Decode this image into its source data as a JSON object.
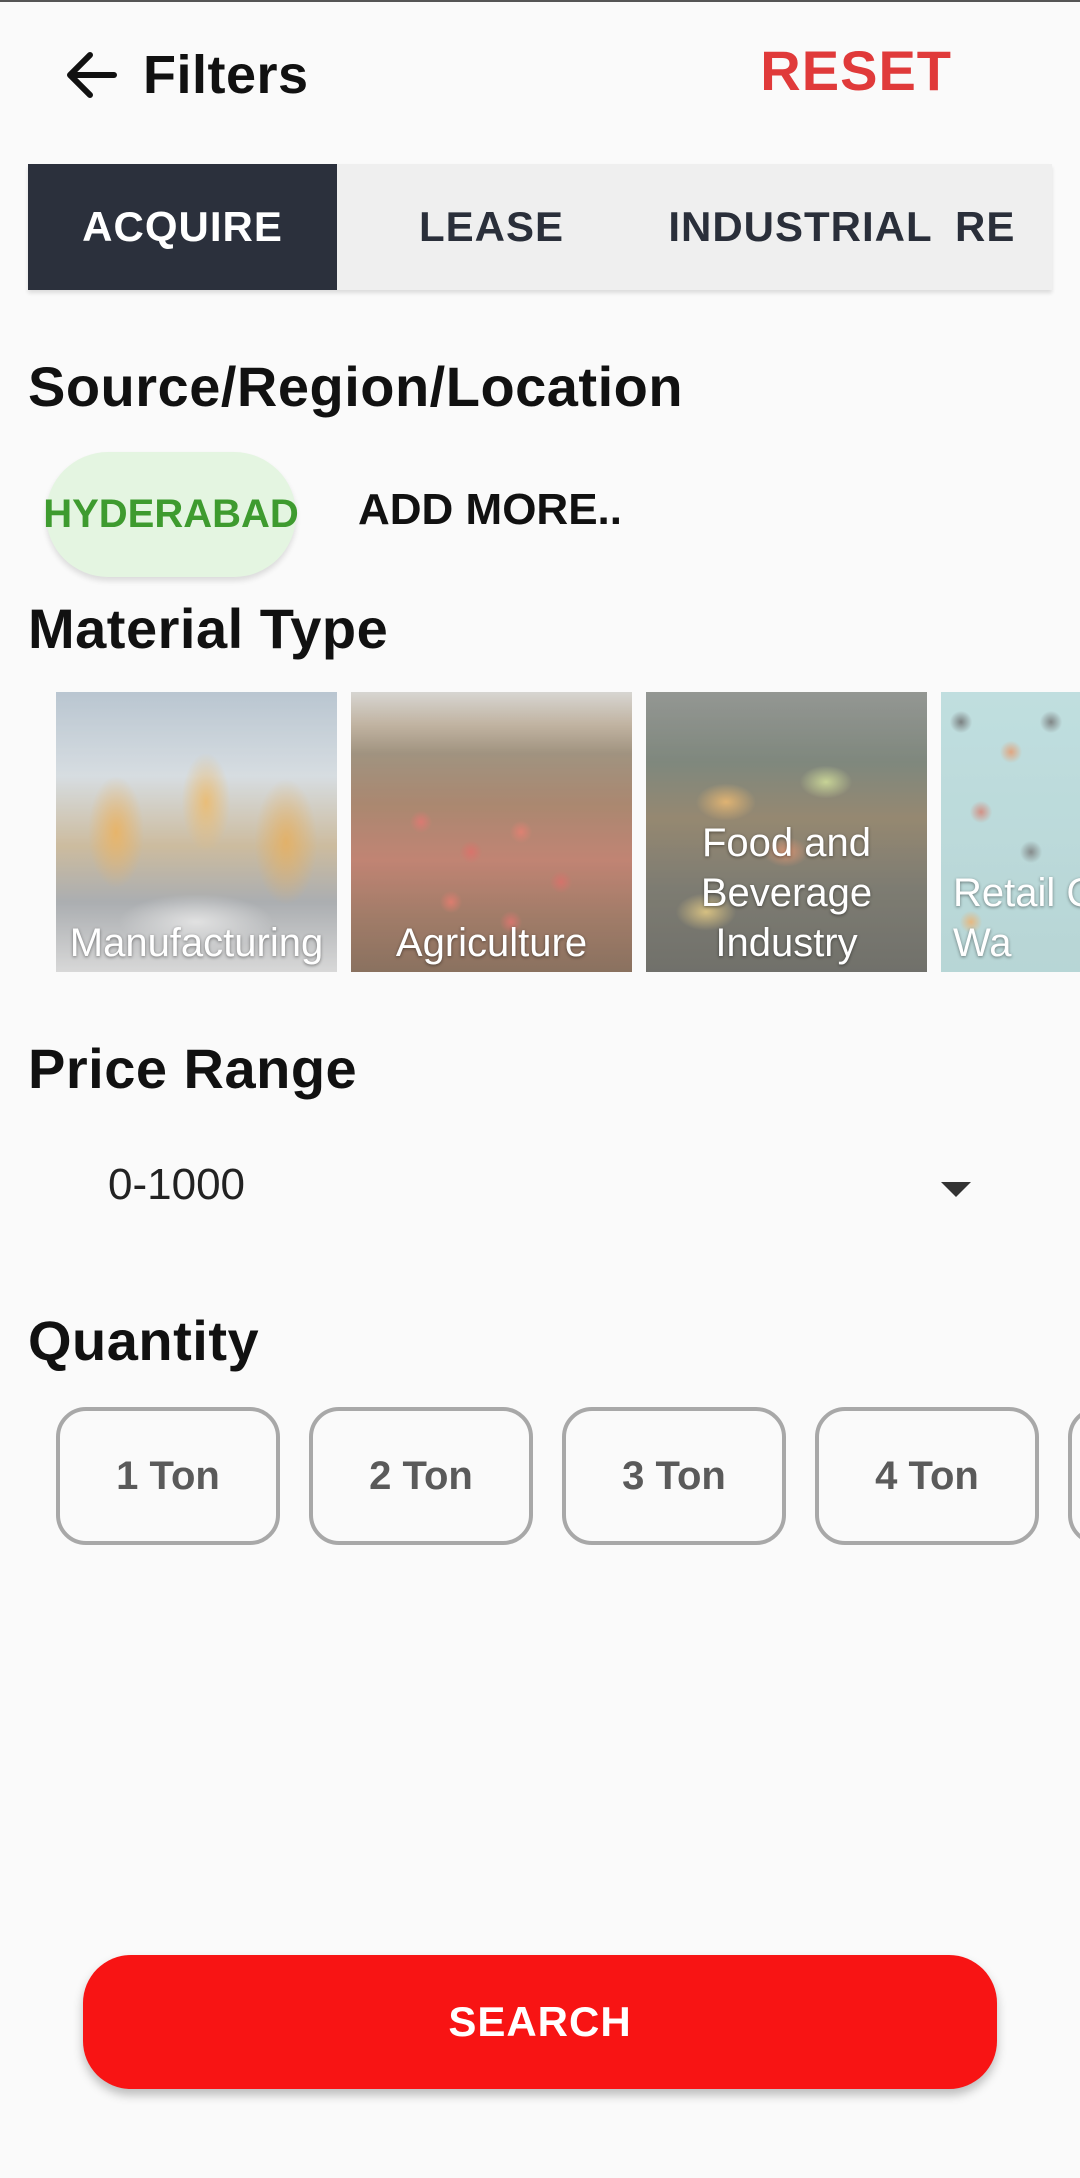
{
  "header": {
    "title": "Filters",
    "reset_label": "RESET"
  },
  "tabs": [
    {
      "label": "ACQUIRE",
      "active": true
    },
    {
      "label": "LEASE",
      "active": false
    },
    {
      "label": "INDUSTRIAL",
      "active": false
    },
    {
      "label": "RE",
      "active": false
    }
  ],
  "location": {
    "heading": "Source/Region/Location",
    "selected": "HYDERABAD",
    "add_more_label": "ADD MORE.."
  },
  "material": {
    "heading": "Material Type",
    "items": [
      {
        "label": "Manufacturing"
      },
      {
        "label": "Agriculture"
      },
      {
        "label": "Food and Beverage Industry"
      },
      {
        "label": "Retail Comm Wa"
      }
    ]
  },
  "price": {
    "heading": "Price Range",
    "selected": "0-1000"
  },
  "quantity": {
    "heading": "Quantity",
    "options": [
      "1 Ton",
      "2 Ton",
      "3 Ton",
      "4 Ton",
      ""
    ]
  },
  "search_label": "SEARCH",
  "colors": {
    "accent_red": "#f81414",
    "reset_red": "#e03a3a",
    "active_tab": "#2b303c",
    "location_chip_bg": "#e4f5e1",
    "location_chip_text": "#3e9b2f"
  },
  "icons": {
    "back": "arrow-left-icon",
    "dropdown": "caret-down-icon"
  }
}
